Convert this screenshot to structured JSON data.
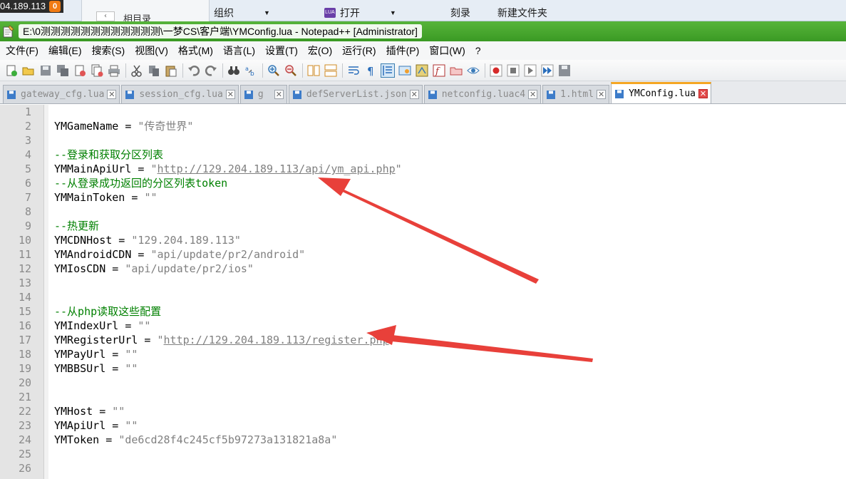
{
  "taskbar": {
    "ip": "04.189.113",
    "badge": "0"
  },
  "explorer": {
    "back": "‹",
    "crumb": "相目录",
    "toolbar": [
      "组织",
      "打开",
      "刻录",
      "新建文件夹"
    ]
  },
  "window": {
    "title": "E:\\0测测测测测测测测测测测测\\一梦CS\\客户端\\YMConfig.lua - Notepad++ [Administrator]"
  },
  "menu": [
    "文件(F)",
    "编辑(E)",
    "搜索(S)",
    "视图(V)",
    "格式(M)",
    "语言(L)",
    "设置(T)",
    "宏(O)",
    "运行(R)",
    "插件(P)",
    "窗口(W)",
    "?"
  ],
  "tabs": [
    {
      "label": "gateway_cfg.lua",
      "active": false
    },
    {
      "label": "session_cfg.lua",
      "active": false
    },
    {
      "label": "g",
      "active": false
    },
    {
      "label": "defServerList.json",
      "active": false
    },
    {
      "label": "netconfig.luac4",
      "active": false
    },
    {
      "label": "1.html",
      "active": false
    },
    {
      "label": "YMConfig.lua",
      "active": true
    }
  ],
  "lines": [
    {
      "n": "1",
      "parts": []
    },
    {
      "n": "2",
      "parts": [
        {
          "t": "YMGameName",
          "c": "ident"
        },
        {
          "t": " = ",
          "c": "op"
        },
        {
          "t": "\"传奇世界\"",
          "c": "str"
        }
      ]
    },
    {
      "n": "3",
      "parts": []
    },
    {
      "n": "4",
      "parts": [
        {
          "t": "--登录和获取分区列表",
          "c": "cmt"
        }
      ]
    },
    {
      "n": "5",
      "parts": [
        {
          "t": "YMMainApiUrl",
          "c": "ident"
        },
        {
          "t": " = ",
          "c": "op"
        },
        {
          "t": "\"",
          "c": "str"
        },
        {
          "t": "http://129.204.189.113/api/ym_api.php",
          "c": "url"
        },
        {
          "t": "\"",
          "c": "str"
        }
      ]
    },
    {
      "n": "6",
      "parts": [
        {
          "t": "--从登录成功返回的分区列表token",
          "c": "cmt"
        }
      ]
    },
    {
      "n": "7",
      "parts": [
        {
          "t": "YMMainToken",
          "c": "ident"
        },
        {
          "t": " = ",
          "c": "op"
        },
        {
          "t": "\"\"",
          "c": "str"
        }
      ]
    },
    {
      "n": "8",
      "parts": []
    },
    {
      "n": "9",
      "parts": [
        {
          "t": "--热更新",
          "c": "cmt"
        }
      ]
    },
    {
      "n": "10",
      "parts": [
        {
          "t": "YMCDNHost",
          "c": "ident"
        },
        {
          "t": " = ",
          "c": "op"
        },
        {
          "t": "\"129.204.189.113\"",
          "c": "str"
        }
      ]
    },
    {
      "n": "11",
      "parts": [
        {
          "t": "YMAndroidCDN",
          "c": "ident"
        },
        {
          "t": " = ",
          "c": "op"
        },
        {
          "t": "\"api/update/pr2/android\"",
          "c": "str"
        }
      ]
    },
    {
      "n": "12",
      "parts": [
        {
          "t": "YMIosCDN",
          "c": "ident"
        },
        {
          "t": " = ",
          "c": "op"
        },
        {
          "t": "\"api/update/pr2/ios\"",
          "c": "str"
        }
      ]
    },
    {
      "n": "13",
      "parts": []
    },
    {
      "n": "14",
      "parts": []
    },
    {
      "n": "15",
      "parts": [
        {
          "t": "--从php读取这些配置",
          "c": "cmt"
        }
      ]
    },
    {
      "n": "16",
      "parts": [
        {
          "t": "YMIndexUrl",
          "c": "ident"
        },
        {
          "t": " = ",
          "c": "op"
        },
        {
          "t": "\"\"",
          "c": "str"
        }
      ]
    },
    {
      "n": "17",
      "parts": [
        {
          "t": "YMRegisterUrl",
          "c": "ident"
        },
        {
          "t": " = ",
          "c": "op"
        },
        {
          "t": "\"",
          "c": "str"
        },
        {
          "t": "http://129.204.189.113/register.php",
          "c": "url"
        },
        {
          "t": "\"",
          "c": "str"
        }
      ]
    },
    {
      "n": "18",
      "parts": [
        {
          "t": "YMPayUrl",
          "c": "ident"
        },
        {
          "t": " = ",
          "c": "op"
        },
        {
          "t": "\"\"",
          "c": "str"
        }
      ]
    },
    {
      "n": "19",
      "parts": [
        {
          "t": "YMBBSUrl",
          "c": "ident"
        },
        {
          "t": " = ",
          "c": "op"
        },
        {
          "t": "\"\"",
          "c": "str"
        }
      ]
    },
    {
      "n": "20",
      "parts": []
    },
    {
      "n": "21",
      "parts": []
    },
    {
      "n": "22",
      "parts": [
        {
          "t": "YMHost",
          "c": "ident"
        },
        {
          "t": " = ",
          "c": "op"
        },
        {
          "t": "\"\"",
          "c": "str"
        }
      ]
    },
    {
      "n": "23",
      "parts": [
        {
          "t": "YMApiUrl",
          "c": "ident"
        },
        {
          "t": " = ",
          "c": "op"
        },
        {
          "t": "\"\"",
          "c": "str"
        }
      ]
    },
    {
      "n": "24",
      "parts": [
        {
          "t": "YMToken",
          "c": "ident"
        },
        {
          "t": " = ",
          "c": "op"
        },
        {
          "t": "\"de6cd28f4c245cf5b97273a131821a8a\"",
          "c": "str"
        }
      ]
    },
    {
      "n": "25",
      "parts": []
    },
    {
      "n": "26",
      "parts": []
    }
  ],
  "colors": {
    "titlebar": "#3a9a24",
    "comment": "#008000",
    "string": "#808080",
    "arrow": "#e8403a",
    "active_tab_accent": "#f5a623"
  }
}
